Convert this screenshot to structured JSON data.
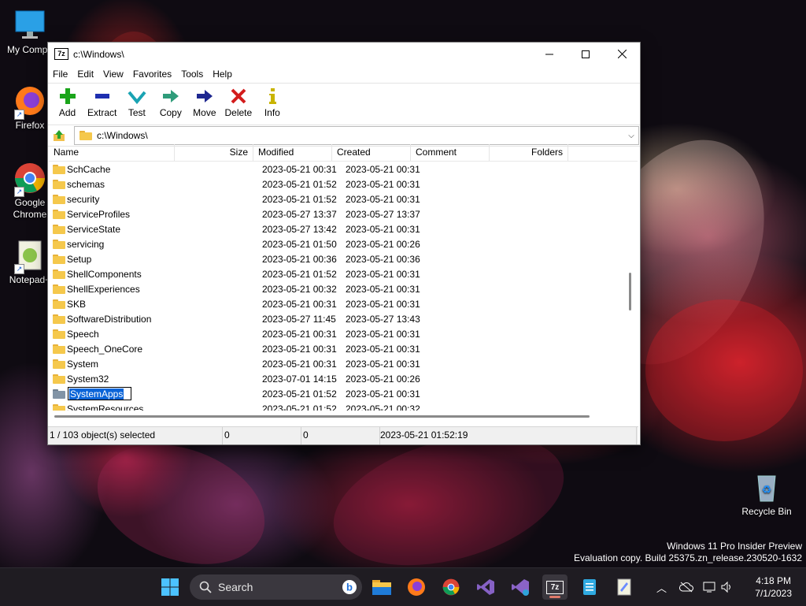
{
  "desktop": {
    "icons": [
      {
        "label": "My Compu"
      },
      {
        "label": "Firefox"
      },
      {
        "label": "Google Chrome"
      },
      {
        "label": "Notepad+"
      },
      {
        "label": "Recycle Bin"
      }
    ],
    "watermark": {
      "line1": "Windows 11 Pro Insider Preview",
      "line2": "Evaluation copy. Build 25375.zn_release.230520-1632"
    }
  },
  "window": {
    "title": "c:\\Windows\\",
    "app_icon_text": "7z",
    "menu": [
      "File",
      "Edit",
      "View",
      "Favorites",
      "Tools",
      "Help"
    ],
    "toolbar": [
      "Add",
      "Extract",
      "Test",
      "Copy",
      "Move",
      "Delete",
      "Info"
    ],
    "address": "c:\\Windows\\",
    "columns": [
      "Name",
      "Size",
      "Modified",
      "Created",
      "Comment",
      "Folders"
    ],
    "rows": [
      {
        "name": "SchCache",
        "modified": "2023-05-21 00:31",
        "created": "2023-05-21 00:31"
      },
      {
        "name": "schemas",
        "modified": "2023-05-21 01:52",
        "created": "2023-05-21 00:31"
      },
      {
        "name": "security",
        "modified": "2023-05-21 01:52",
        "created": "2023-05-21 00:31"
      },
      {
        "name": "ServiceProfiles",
        "modified": "2023-05-27 13:37",
        "created": "2023-05-27 13:37"
      },
      {
        "name": "ServiceState",
        "modified": "2023-05-27 13:42",
        "created": "2023-05-21 00:31"
      },
      {
        "name": "servicing",
        "modified": "2023-05-21 01:50",
        "created": "2023-05-21 00:26"
      },
      {
        "name": "Setup",
        "modified": "2023-05-21 00:36",
        "created": "2023-05-21 00:36"
      },
      {
        "name": "ShellComponents",
        "modified": "2023-05-21 01:52",
        "created": "2023-05-21 00:31"
      },
      {
        "name": "ShellExperiences",
        "modified": "2023-05-21 00:32",
        "created": "2023-05-21 00:31"
      },
      {
        "name": "SKB",
        "modified": "2023-05-21 00:31",
        "created": "2023-05-21 00:31"
      },
      {
        "name": "SoftwareDistribution",
        "modified": "2023-05-27 11:45",
        "created": "2023-05-27 13:43"
      },
      {
        "name": "Speech",
        "modified": "2023-05-21 00:31",
        "created": "2023-05-21 00:31"
      },
      {
        "name": "Speech_OneCore",
        "modified": "2023-05-21 00:31",
        "created": "2023-05-21 00:31"
      },
      {
        "name": "System",
        "modified": "2023-05-21 00:31",
        "created": "2023-05-21 00:31"
      },
      {
        "name": "System32",
        "modified": "2023-07-01 14:15",
        "created": "2023-05-21 00:26"
      },
      {
        "name": "SystemApps",
        "modified": "2023-05-21 01:52",
        "created": "2023-05-21 00:31"
      },
      {
        "name": "SystemResources",
        "modified": "2023-05-21 01:52",
        "created": "2023-05-21 00:32"
      }
    ],
    "status": {
      "selection": "1 / 103 object(s) selected",
      "size": "0",
      "packed": "0",
      "date": "2023-05-21 01:52:19"
    }
  },
  "taskbar": {
    "search_label": "Search",
    "time": "4:18 PM",
    "date": "7/1/2023",
    "app_icon_text": "7z"
  },
  "colors": {
    "taskbar": "#1f1c22",
    "selection": "#0a64d8",
    "folder": "#f5c84c"
  }
}
